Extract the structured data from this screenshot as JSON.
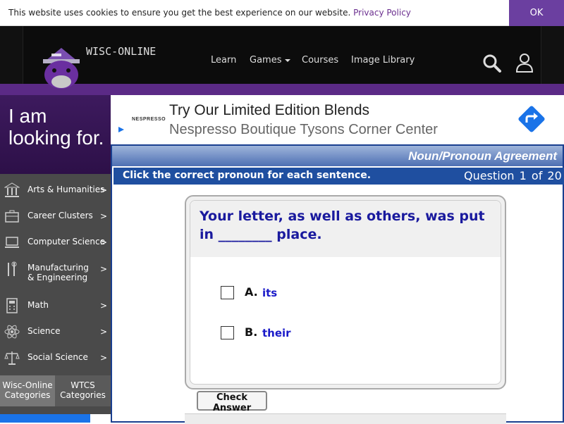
{
  "cookie": {
    "text": "This website uses cookies to ensure you get the best experience on our website.",
    "link": "Privacy Policy",
    "ok": "OK"
  },
  "header": {
    "logo_text": "WISC-ONLINE",
    "nav": [
      "Learn",
      "Games",
      "Courses",
      "Image Library"
    ],
    "icons": [
      "search-icon",
      "user-icon"
    ]
  },
  "colors": {
    "brand_purple": "#5b2a86",
    "accent_purple": "#6b3fa0",
    "activity_blue": "#1f4fa0",
    "question_text": "#1a1a9e"
  },
  "sidebar": {
    "hero": "I am looking for.",
    "items": [
      {
        "label": "Arts & Humanities",
        "icon": "columns-icon"
      },
      {
        "label": "Career Clusters",
        "icon": "briefcase-icon"
      },
      {
        "label": "Computer Science",
        "icon": "laptop-icon"
      },
      {
        "label": "Manufacturing & Engineering",
        "icon": "tools-icon"
      },
      {
        "label": "Math",
        "icon": "calculator-icon"
      },
      {
        "label": "Science",
        "icon": "atom-icon"
      },
      {
        "label": "Social Science",
        "icon": "scales-icon"
      }
    ],
    "arrow": ">",
    "tabs": [
      "Wisc-Online Categories",
      "WTCS Categories"
    ]
  },
  "ad": {
    "brand": "NESPRESSO",
    "title": "Try Our Limited Edition Blends",
    "subtitle": "Nespresso Boutique Tysons Corner Center"
  },
  "activity": {
    "title": "Noun/Pronoun Agreement",
    "instruction": "Click the correct pronoun for each sentence.",
    "counter": "Question 1 of 20",
    "question": "Your letter, as well as others, was put in ________ place.",
    "options": [
      {
        "letter": "A.",
        "text": "its"
      },
      {
        "letter": "B.",
        "text": "their"
      }
    ],
    "check": "Check Answer"
  }
}
